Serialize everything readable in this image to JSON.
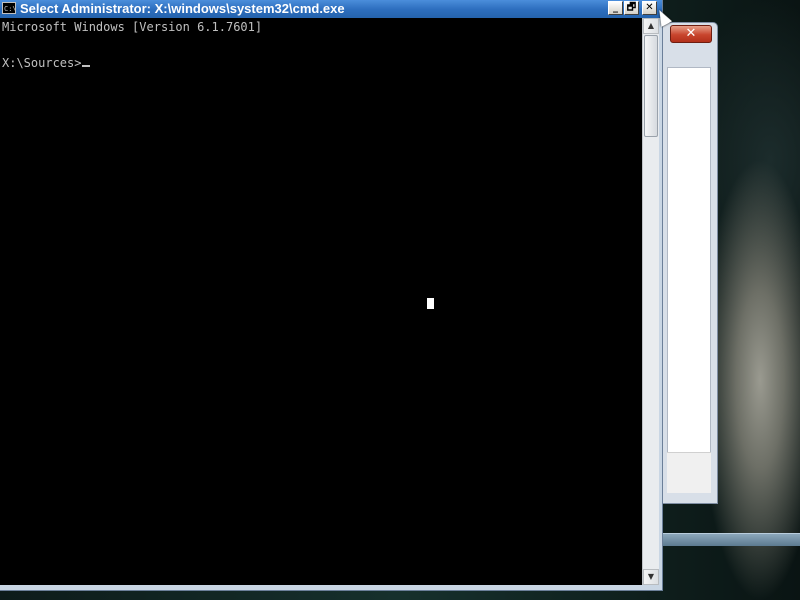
{
  "window": {
    "title": "Select Administrator: X:\\windows\\system32\\cmd.exe",
    "icon": "cmd-icon",
    "icon_text": "C:\\",
    "buttons": {
      "minimize": "_",
      "maximize": "🗗",
      "close": "✕"
    }
  },
  "console": {
    "lines": [
      "Microsoft Windows [Version 6.1.7601]",
      "",
      "X:\\Sources>"
    ]
  },
  "background_window": {
    "close_label": "✕"
  },
  "scrollbar": {
    "up": "▲",
    "down": "▼"
  },
  "colors": {
    "console_bg": "#000000",
    "console_text": "#c0c0c0",
    "titlebar": "#2e6fbf"
  }
}
